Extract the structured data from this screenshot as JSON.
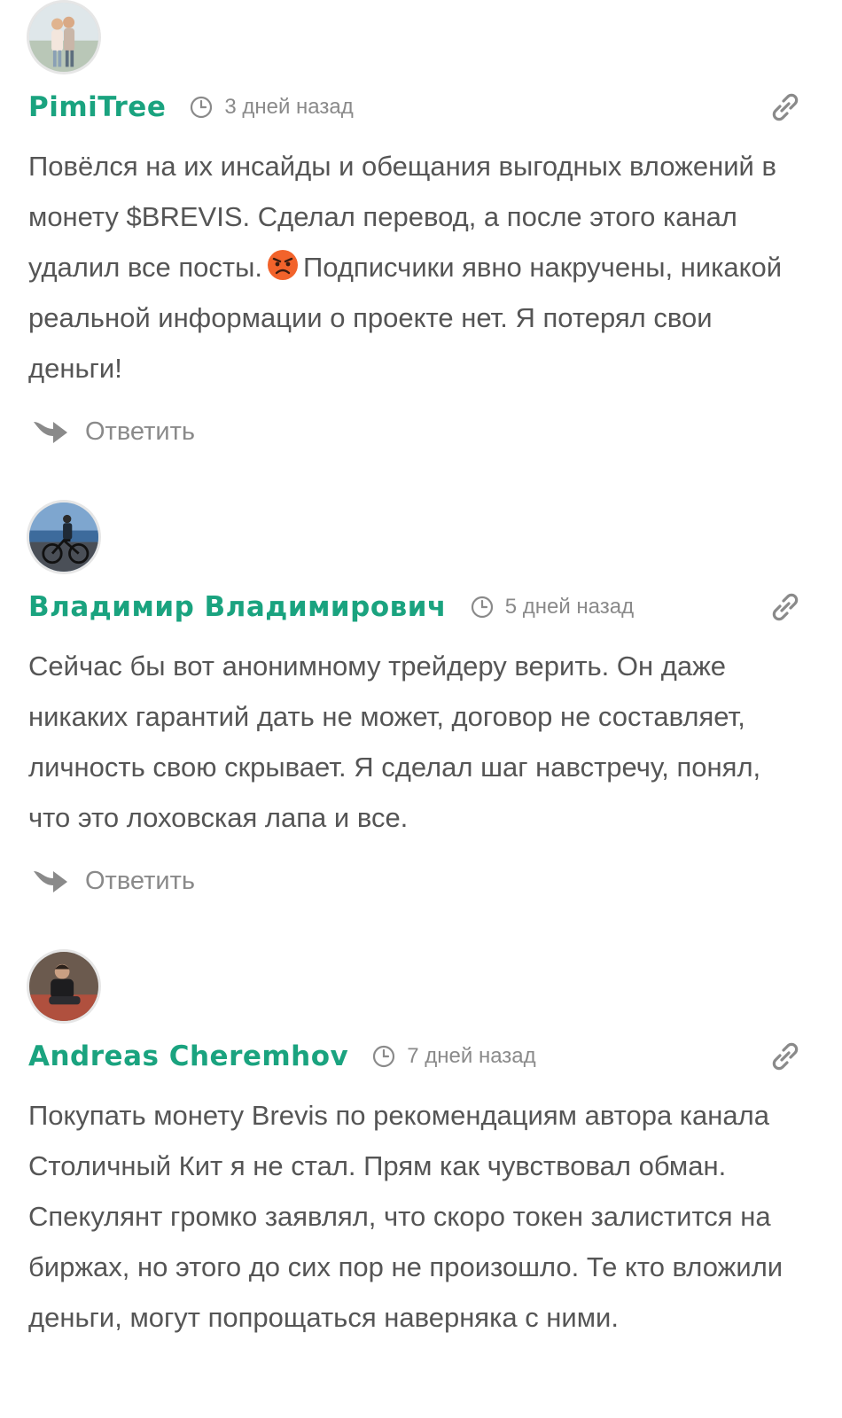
{
  "comments": [
    {
      "author": "PimiTree",
      "time": "3 дней назад",
      "text_before": "Повёлся на их инсайды и обещания выгодных вложений в монету $BREVIS. Сделал перевод, а после этого канал удалил все посты.",
      "emoji": "angry-face",
      "text_after": "Подписчики явно накручены, никакой реальной информации о проекте нет. Я потерял свои деньги!",
      "reply_label": "Ответить"
    },
    {
      "author": "Владимир Владимирович",
      "time": "5 дней назад",
      "text": "Сейчас бы вот анонимному трейдеру верить. Он даже никаких гарантий дать не может, договор не составляет, личность свою скрывает. Я сделал шаг навстречу, понял, что это лоховская лапа и все.",
      "reply_label": "Ответить"
    },
    {
      "author": "Andreas Cheremhov",
      "time": "7 дней назад",
      "text": "Покупать монету Brevis по рекомендациям автора канала Столичный Кит я не стал. Прям как чувствовал обман. Спекулянт громко заявлял, что скоро токен залистится на биржах, но этого до сих пор не произошло. Те кто вложили деньги, могут попрощаться наверняка с ними."
    }
  ],
  "colors": {
    "author": "#1aa37f",
    "text": "#555555",
    "meta": "#8a8a8a"
  },
  "icons": {
    "time": "clock-icon",
    "permalink": "link-icon",
    "reply": "reply-arrow-icon"
  }
}
